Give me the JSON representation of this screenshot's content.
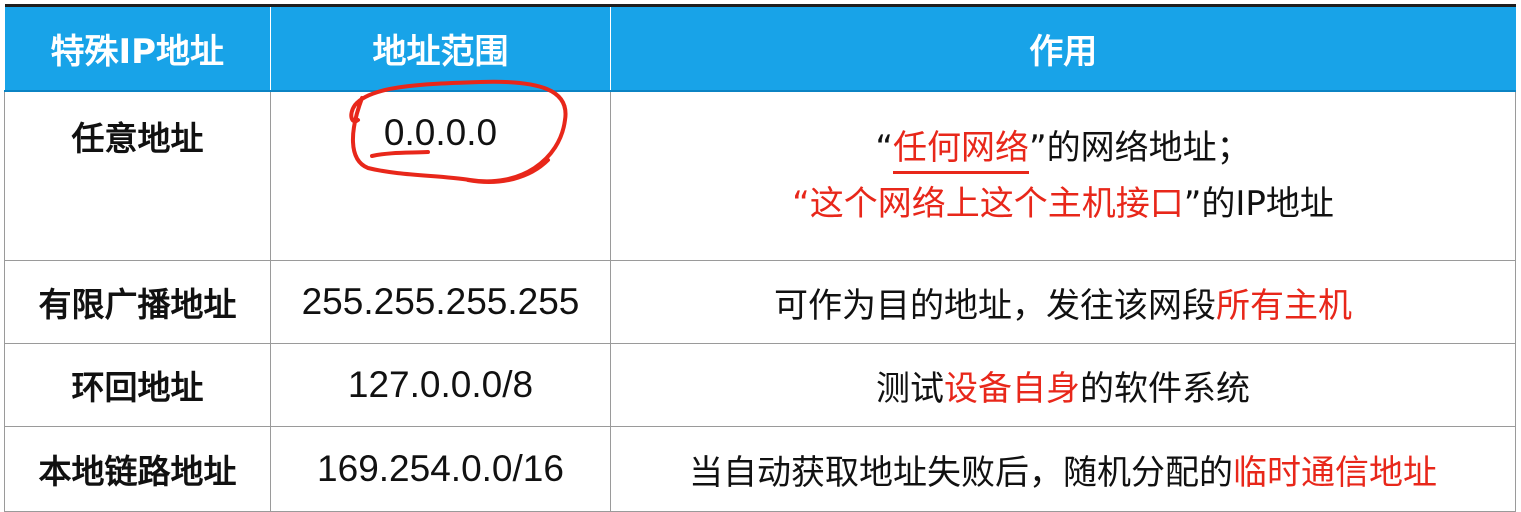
{
  "table": {
    "headers": [
      "特殊IP地址",
      "地址范围",
      "作用"
    ],
    "rows": [
      {
        "name": "任意地址",
        "range": "0.0.0.0",
        "purpose": {
          "line1": {
            "q_open": "“",
            "red": "任何网络",
            "q_close": "”",
            "rest": "的网络地址；"
          },
          "line2": {
            "q_open": "“",
            "red": "这个网络上这个主机接口",
            "q_close": "”",
            "rest": "的IP地址"
          }
        }
      },
      {
        "name": "有限广播地址",
        "range": "255.255.255.255",
        "purpose": {
          "pre": "可作为目的地址，发往该网段",
          "red": "所有主机",
          "post": ""
        }
      },
      {
        "name": "环回地址",
        "range": "127.0.0.0/8",
        "purpose": {
          "pre": "测试",
          "red": "设备自身",
          "post": "的软件系统"
        }
      },
      {
        "name": "本地链路地址",
        "range": "169.254.0.0/16",
        "purpose": {
          "pre": "当自动获取地址失败后，随机分配的",
          "red": "临时通信地址",
          "post": ""
        }
      }
    ]
  },
  "colors": {
    "header_bg": "#18a3e8",
    "header_text": "#ffffff",
    "highlight": "#e8271a",
    "border": "#9a9a9a"
  }
}
